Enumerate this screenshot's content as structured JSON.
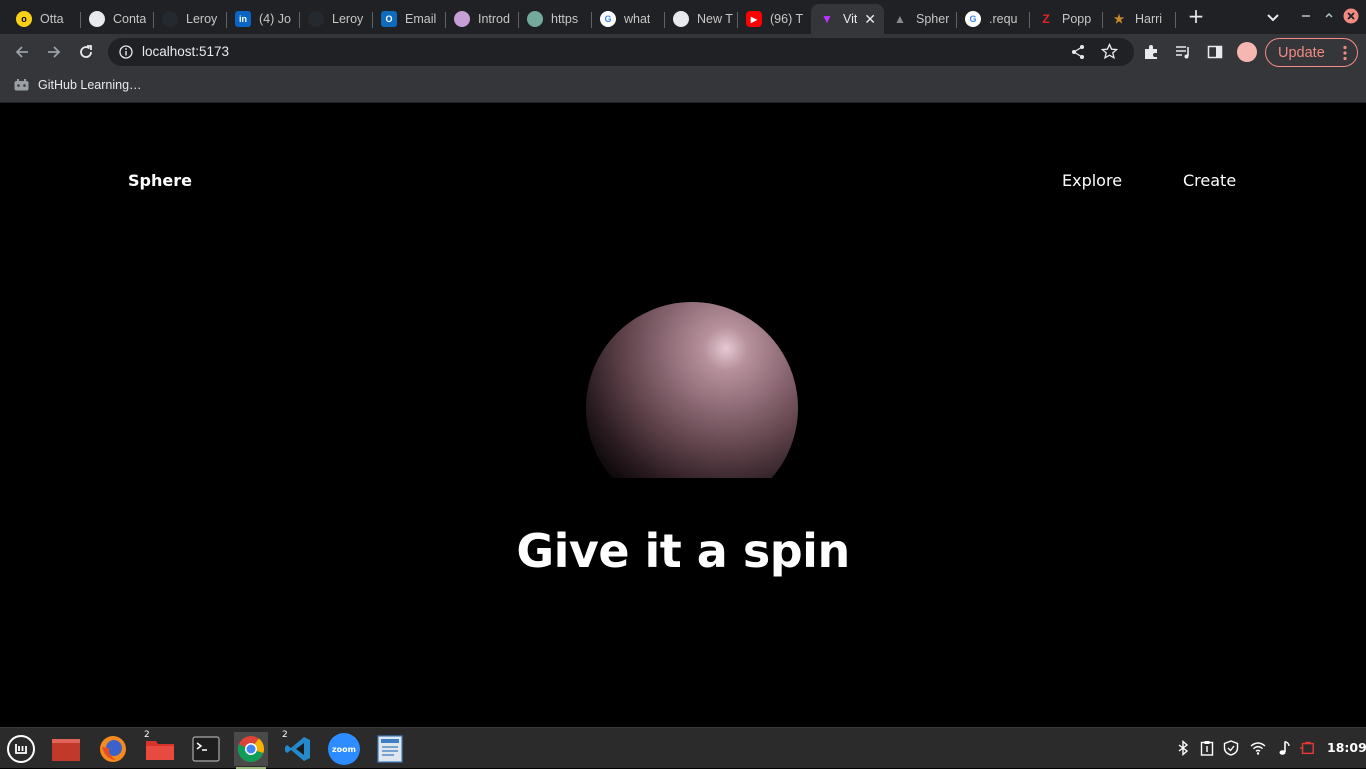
{
  "browser": {
    "tabs": [
      {
        "title": "Otta",
        "favicon": "otta-icon",
        "color": "#f7d117"
      },
      {
        "title": "Conta",
        "favicon": "globe-icon",
        "color": "#e8eaed"
      },
      {
        "title": "Leroy",
        "favicon": "github-icon",
        "color": "#24292f"
      },
      {
        "title": "(4) Jo",
        "favicon": "linkedin-icon",
        "color": "#0a66c2"
      },
      {
        "title": "Leroy",
        "favicon": "github-icon",
        "color": "#24292f"
      },
      {
        "title": "Email",
        "favicon": "outlook-icon",
        "color": "#0f6cbd"
      },
      {
        "title": "Introd",
        "favicon": "openai-icon",
        "color": "#c79fd6"
      },
      {
        "title": "https",
        "favicon": "chatgpt-icon",
        "color": "#74aa9c"
      },
      {
        "title": "what",
        "favicon": "google-icon",
        "color": "#ffffff"
      },
      {
        "title": "New T",
        "favicon": "chrome-icon",
        "color": "#e8eaed"
      },
      {
        "title": "(96) T",
        "favicon": "youtube-icon",
        "color": "#ff0000"
      },
      {
        "title": "Vit",
        "favicon": "vite-icon",
        "color": "#bd34fe",
        "active": true
      },
      {
        "title": "Spher",
        "favicon": "vercel-icon",
        "color": "#1f1f1f"
      },
      {
        "title": ".requ",
        "favicon": "google-icon",
        "color": "#ffffff"
      },
      {
        "title": "Popp",
        "favicon": "zoho-icon",
        "color": "#e42527"
      },
      {
        "title": "Harri",
        "favicon": "star-icon",
        "color": "#c58a2a"
      }
    ],
    "new_tab_label": "+",
    "url": "localhost:5173",
    "update_label": "Update",
    "bookmarks": [
      {
        "label": "GitHub Learning…"
      }
    ]
  },
  "page": {
    "logo": "Sphere",
    "nav": {
      "explore": "Explore",
      "create": "Create"
    },
    "headline": "Give it a spin"
  },
  "taskbar": {
    "apps": [
      {
        "name": "mint-menu-icon"
      },
      {
        "name": "show-desktop-icon"
      },
      {
        "name": "firefox-icon"
      },
      {
        "name": "files-icon",
        "badge": "2"
      },
      {
        "name": "terminal-icon"
      },
      {
        "name": "chrome-icon",
        "active": true
      },
      {
        "name": "vscode-icon",
        "badge": "2"
      },
      {
        "name": "zoom-icon",
        "label": "zoom"
      },
      {
        "name": "text-editor-icon"
      }
    ],
    "clock": "18:09"
  }
}
